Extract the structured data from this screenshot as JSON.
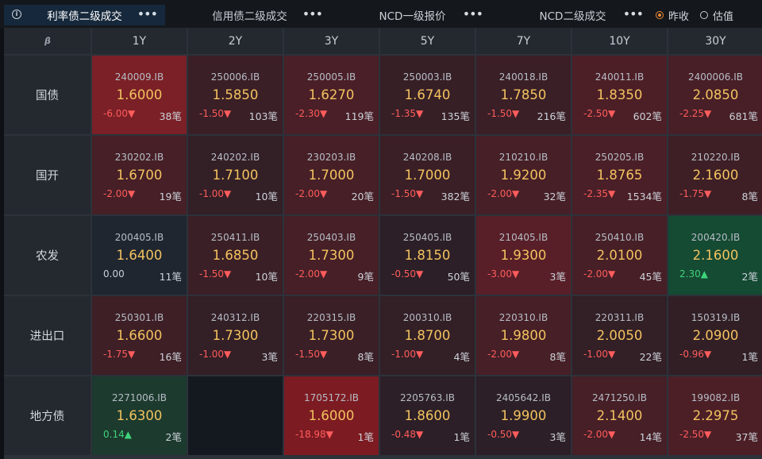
{
  "tabs": [
    {
      "label": "利率债二级成交",
      "active": true
    },
    {
      "label": "信用债二级成交",
      "active": false
    },
    {
      "label": "NCD一级报价",
      "active": false
    },
    {
      "label": "NCD二级成交",
      "active": false
    }
  ],
  "radios": [
    {
      "label": "昨收",
      "selected": true
    },
    {
      "label": "估值",
      "selected": false
    }
  ],
  "corner_icon": "β",
  "more_icon": "•••",
  "info_glyph": "i",
  "columns": [
    "1Y",
    "2Y",
    "3Y",
    "5Y",
    "7Y",
    "10Y",
    "30Y"
  ],
  "rows": [
    {
      "name": "国债",
      "cells": [
        {
          "code": "240009.IB",
          "yield": "1.6000",
          "chg": "-6.00▼",
          "count": "38笔",
          "dir": "down",
          "bg": "#7a2026"
        },
        {
          "code": "250006.IB",
          "yield": "1.5850",
          "chg": "-1.50▼",
          "count": "103笔",
          "dir": "down",
          "bg": "#3a1f26"
        },
        {
          "code": "250005.IB",
          "yield": "1.6270",
          "chg": "-2.30▼",
          "count": "119笔",
          "dir": "down",
          "bg": "#4a1f27"
        },
        {
          "code": "250003.IB",
          "yield": "1.6740",
          "chg": "-1.35▼",
          "count": "135笔",
          "dir": "down",
          "bg": "#371f26"
        },
        {
          "code": "240018.IB",
          "yield": "1.7850",
          "chg": "-1.50▼",
          "count": "216笔",
          "dir": "down",
          "bg": "#3a1f26"
        },
        {
          "code": "240011.IB",
          "yield": "1.8350",
          "chg": "-2.50▼",
          "count": "602笔",
          "dir": "down",
          "bg": "#4c1f27"
        },
        {
          "code": "2400006.IB",
          "yield": "2.0850",
          "chg": "-2.25▼",
          "count": "681笔",
          "dir": "down",
          "bg": "#481f27"
        }
      ]
    },
    {
      "name": "国开",
      "cells": [
        {
          "code": "230202.IB",
          "yield": "1.6700",
          "chg": "-2.00▼",
          "count": "19笔",
          "dir": "down",
          "bg": "#461f27"
        },
        {
          "code": "240202.IB",
          "yield": "1.7100",
          "chg": "-1.00▼",
          "count": "10笔",
          "dir": "down",
          "bg": "#331f26"
        },
        {
          "code": "230203.IB",
          "yield": "1.7000",
          "chg": "-2.00▼",
          "count": "20笔",
          "dir": "down",
          "bg": "#461f27"
        },
        {
          "code": "240208.IB",
          "yield": "1.7000",
          "chg": "-1.50▼",
          "count": "382笔",
          "dir": "down",
          "bg": "#3a1f26"
        },
        {
          "code": "210210.IB",
          "yield": "1.9200",
          "chg": "-2.00▼",
          "count": "32笔",
          "dir": "down",
          "bg": "#461f27"
        },
        {
          "code": "250205.IB",
          "yield": "1.8765",
          "chg": "-2.35▼",
          "count": "1534笔",
          "dir": "down",
          "bg": "#4a1f27"
        },
        {
          "code": "210220.IB",
          "yield": "2.1600",
          "chg": "-1.75▼",
          "count": "8笔",
          "dir": "down",
          "bg": "#3e1f26"
        }
      ]
    },
    {
      "name": "农发",
      "cells": [
        {
          "code": "200405.IB",
          "yield": "1.6400",
          "chg": "0.00",
          "count": "11笔",
          "dir": "flat",
          "bg": "#1f2630"
        },
        {
          "code": "250411.IB",
          "yield": "1.6850",
          "chg": "-1.50▼",
          "count": "10笔",
          "dir": "down",
          "bg": "#3a1f26"
        },
        {
          "code": "250403.IB",
          "yield": "1.7300",
          "chg": "-2.00▼",
          "count": "9笔",
          "dir": "down",
          "bg": "#461f27"
        },
        {
          "code": "250405.IB",
          "yield": "1.8150",
          "chg": "-0.50▼",
          "count": "50笔",
          "dir": "down",
          "bg": "#2c1f27"
        },
        {
          "code": "210405.IB",
          "yield": "1.9300",
          "chg": "-3.00▼",
          "count": "3笔",
          "dir": "down",
          "bg": "#581f28"
        },
        {
          "code": "250410.IB",
          "yield": "2.0100",
          "chg": "-2.00▼",
          "count": "45笔",
          "dir": "down",
          "bg": "#461f27"
        },
        {
          "code": "200420.IB",
          "yield": "2.1600",
          "chg": "2.30▲",
          "count": "2笔",
          "dir": "up",
          "bg": "#154a33"
        }
      ]
    },
    {
      "name": "进出口",
      "cells": [
        {
          "code": "250301.IB",
          "yield": "1.6600",
          "chg": "-1.75▼",
          "count": "16笔",
          "dir": "down",
          "bg": "#3e1f26"
        },
        {
          "code": "240312.IB",
          "yield": "1.7300",
          "chg": "-1.00▼",
          "count": "3笔",
          "dir": "down",
          "bg": "#331f26"
        },
        {
          "code": "220315.IB",
          "yield": "1.7300",
          "chg": "-1.50▼",
          "count": "8笔",
          "dir": "down",
          "bg": "#3a1f26"
        },
        {
          "code": "200310.IB",
          "yield": "1.8700",
          "chg": "-1.00▼",
          "count": "4笔",
          "dir": "down",
          "bg": "#331f26"
        },
        {
          "code": "220310.IB",
          "yield": "1.9800",
          "chg": "-2.00▼",
          "count": "8笔",
          "dir": "down",
          "bg": "#461f27"
        },
        {
          "code": "220311.IB",
          "yield": "2.0050",
          "chg": "-1.00▼",
          "count": "22笔",
          "dir": "down",
          "bg": "#331f26"
        },
        {
          "code": "150319.IB",
          "yield": "2.0900",
          "chg": "-0.96▼",
          "count": "1笔",
          "dir": "down",
          "bg": "#321f26"
        }
      ]
    },
    {
      "name": "地方债",
      "cells": [
        {
          "code": "2271006.IB",
          "yield": "1.6300",
          "chg": "0.14▲",
          "count": "2笔",
          "dir": "up",
          "bg": "#1c3a2e"
        },
        {
          "empty": true
        },
        {
          "code": "1705172.IB",
          "yield": "1.6000",
          "chg": "-18.98▼",
          "count": "1笔",
          "dir": "down",
          "bg": "#7d1b22"
        },
        {
          "code": "2205763.IB",
          "yield": "1.8600",
          "chg": "-0.48▼",
          "count": "1笔",
          "dir": "down",
          "bg": "#2c1f27"
        },
        {
          "code": "2405642.IB",
          "yield": "1.9900",
          "chg": "-0.50▼",
          "count": "3笔",
          "dir": "down",
          "bg": "#2c1f27"
        },
        {
          "code": "2471250.IB",
          "yield": "2.1400",
          "chg": "-2.00▼",
          "count": "14笔",
          "dir": "down",
          "bg": "#461f27"
        },
        {
          "code": "199082.IB",
          "yield": "2.2975",
          "chg": "-2.50▼",
          "count": "37笔",
          "dir": "down",
          "bg": "#4c1f27"
        }
      ]
    }
  ]
}
